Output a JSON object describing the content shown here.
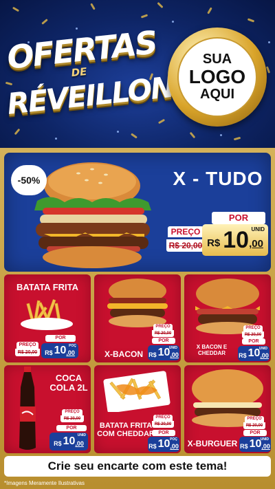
{
  "header": {
    "title_line1": "OFERTAS",
    "title_line2": "DE",
    "title_line3": "RÉVEILLON",
    "logo_line1": "SUA",
    "logo_line2": "LOGO",
    "logo_line3": "AQUI"
  },
  "featured": {
    "discount": "-50%",
    "name": "X - TUDO",
    "preco_label": "PREÇO",
    "old_price": "R$ 20,00",
    "por_label": "POR",
    "currency": "R$",
    "price_int": "10",
    "price_dec": ",00",
    "unit": "UNID"
  },
  "products": [
    {
      "name": "BATATA FRITA",
      "preco_label": "PREÇO",
      "old_price": "R$ 20,00",
      "por_label": "POR",
      "currency": "R$",
      "price_int": "10",
      "price_dec": ",00",
      "unit": "POÇ"
    },
    {
      "name": "X-BACON",
      "preco_label": "PREÇO",
      "old_price": "R$ 20,00",
      "por_label": "POR",
      "currency": "R$",
      "price_int": "10",
      "price_dec": ",00",
      "unit": "UNID"
    },
    {
      "name": "X BACON E CHEDDAR",
      "preco_label": "PREÇO",
      "old_price": "R$ 20,00",
      "por_label": "POR",
      "currency": "R$",
      "price_int": "10",
      "price_dec": ",00",
      "unit": "UNID"
    },
    {
      "name": "COCA COLA 2L",
      "preco_label": "PREÇO",
      "old_price": "R$ 20,00",
      "por_label": "POR",
      "currency": "R$",
      "price_int": "10",
      "price_dec": ",00",
      "unit": "UNID"
    },
    {
      "name": "BATATA FRITA COM CHEDDAR",
      "preco_label": "PREÇO",
      "old_price": "R$ 20,00",
      "por_label": "POR",
      "currency": "R$",
      "price_int": "10",
      "price_dec": ",00",
      "unit": "POÇ"
    },
    {
      "name": "X-BURGUER",
      "preco_label": "PREÇO",
      "old_price": "R$ 20,00",
      "por_label": "POR",
      "currency": "R$",
      "price_int": "10",
      "price_dec": ",00",
      "unit": "UNID"
    }
  ],
  "footer": {
    "cta": "Crie seu encarte com este tema!",
    "disclaimer": "*Imagens Meramente Ilustrativas"
  },
  "colors": {
    "header_bg": "#0e2566",
    "featured_bg": "#1b3f9a",
    "tile_bg": "#c8102e",
    "gold": "#d4b25a"
  }
}
